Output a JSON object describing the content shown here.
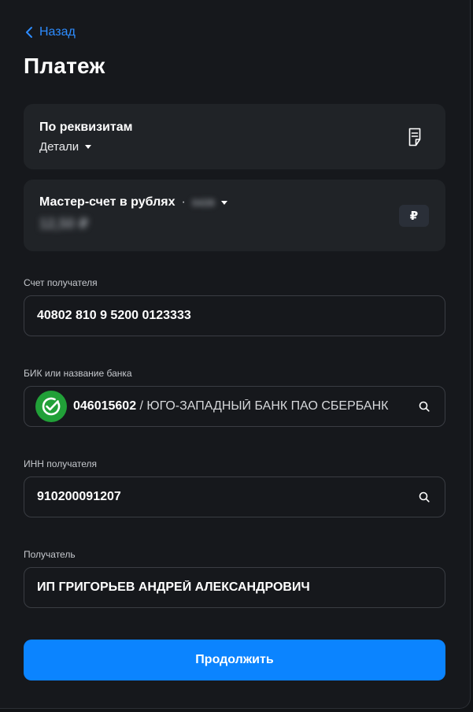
{
  "nav": {
    "back_label": "Назад"
  },
  "page": {
    "title": "Платеж"
  },
  "payment_type": {
    "title": "По реквизитам",
    "details_label": "Детали"
  },
  "account": {
    "name": "Мастер-счет в рублях",
    "separator": "·",
    "number_masked": "0439",
    "balance": "12,50 ₽",
    "currency_symbol": "₽"
  },
  "fields": {
    "recipient_account": {
      "label": "Счет получателя",
      "value": "40802 810 9 5200 0123333"
    },
    "bank": {
      "label": "БИК или название банка",
      "bik": "046015602",
      "name": " / ЮГО-ЗАПАДНЫЙ БАНК ПАО СБЕРБАНК"
    },
    "inn": {
      "label": "ИНН получателя",
      "value": "910200091207"
    },
    "recipient": {
      "label": "Получатель",
      "value": "ИП ГРИГОРЬЕВ АНДРЕЙ АЛЕКСАНДРОВИЧ"
    }
  },
  "actions": {
    "submit_label": "Продолжить"
  },
  "colors": {
    "accent": "#0b84ff",
    "link": "#2d8cff",
    "bank_green": "#21a038"
  }
}
